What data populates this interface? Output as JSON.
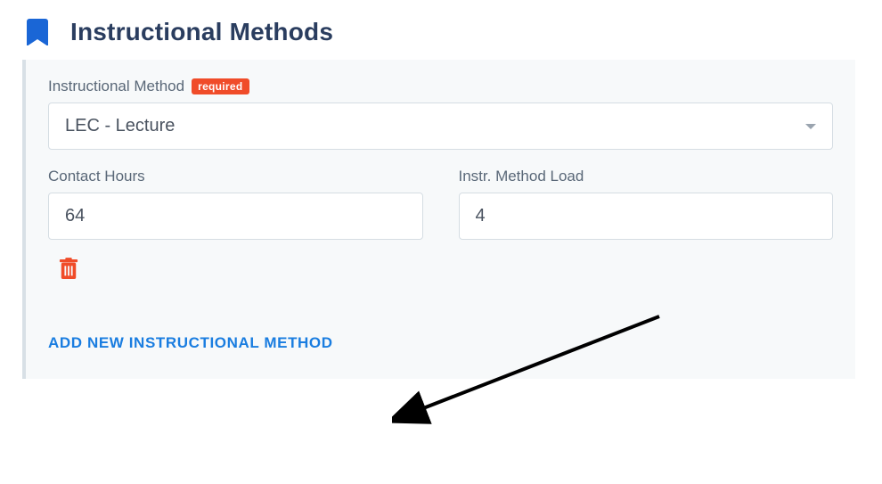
{
  "section": {
    "title": "Instructional Methods"
  },
  "form": {
    "method": {
      "label": "Instructional Method",
      "required_badge": "required",
      "selected": "LEC - Lecture"
    },
    "contact_hours": {
      "label": "Contact Hours",
      "value": "64"
    },
    "method_load": {
      "label": "Instr. Method Load",
      "value": "4"
    },
    "add_link": "ADD NEW INSTRUCTIONAL METHOD"
  }
}
